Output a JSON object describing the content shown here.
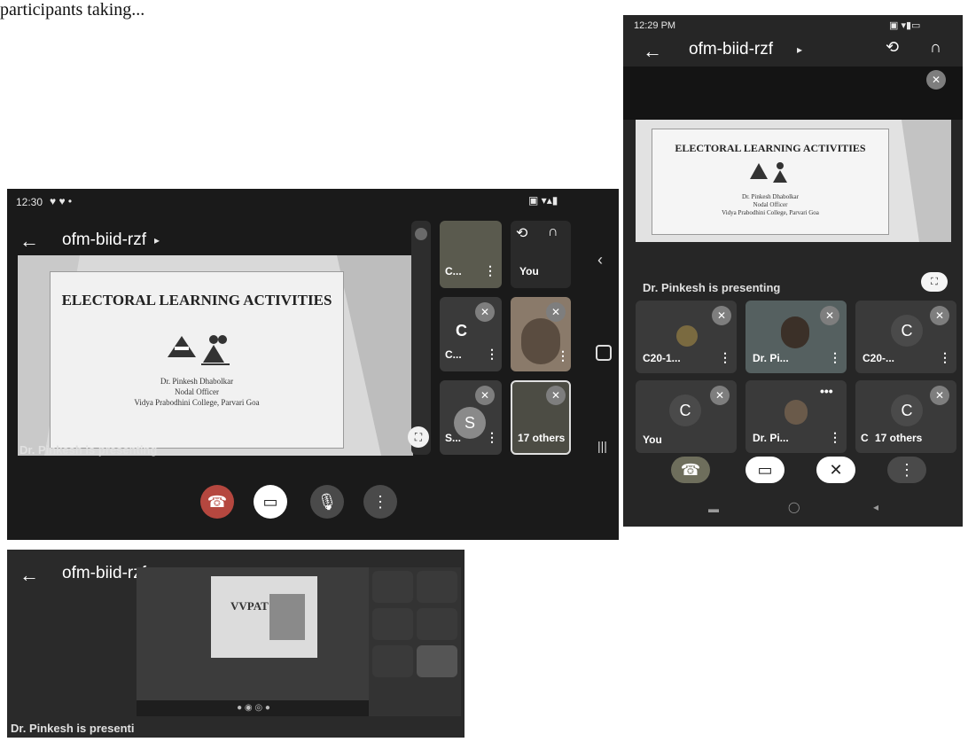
{
  "caption": "participants taking...",
  "shot1": {
    "status_time": "12:30",
    "meeting_title": "ofm-biid-rzf",
    "slide": {
      "title": "ELECTORAL LEARNING ACTIVITIES",
      "name": "Dr. Pinkesh Dhabolkar",
      "role": "Nodal Officer",
      "college": "Vidya Prabodhini College, Parvari Goa"
    },
    "presenting_label": "Dr. Pinkesh is presenting",
    "tiles": {
      "c_top": "C...",
      "you": "You",
      "c_mid_letter": "C",
      "c_mid": "C...",
      "s_letter": "S",
      "s_label": "S...",
      "others": "17 others"
    }
  },
  "shot2": {
    "status_time": "12:29 PM",
    "meeting_title": "ofm-biid-rzf",
    "slide": {
      "title": "ELECTORAL LEARNING ACTIVITIES",
      "name": "Dr. Pinkesh Dhabolkar",
      "role": "Nodal Officer",
      "college": "Vidya Prabodhini College, Parvari Goa"
    },
    "presenting_label": "Dr. Pinkesh is presenting",
    "tiles": {
      "t1": "C20-1...",
      "t2": "Dr. Pi...",
      "t3_letter": "C",
      "t3": "C20-...",
      "t4_letter": "C",
      "t4": "You",
      "t5": "Dr. Pi...",
      "t6_letter": "C",
      "t6_c": "C",
      "t6": "17 others"
    }
  },
  "shot3": {
    "meeting_title": "ofm-biid-rzf",
    "presenting_label": "Dr. Pinkesh is presenti",
    "slide_text": "VVPAT"
  }
}
